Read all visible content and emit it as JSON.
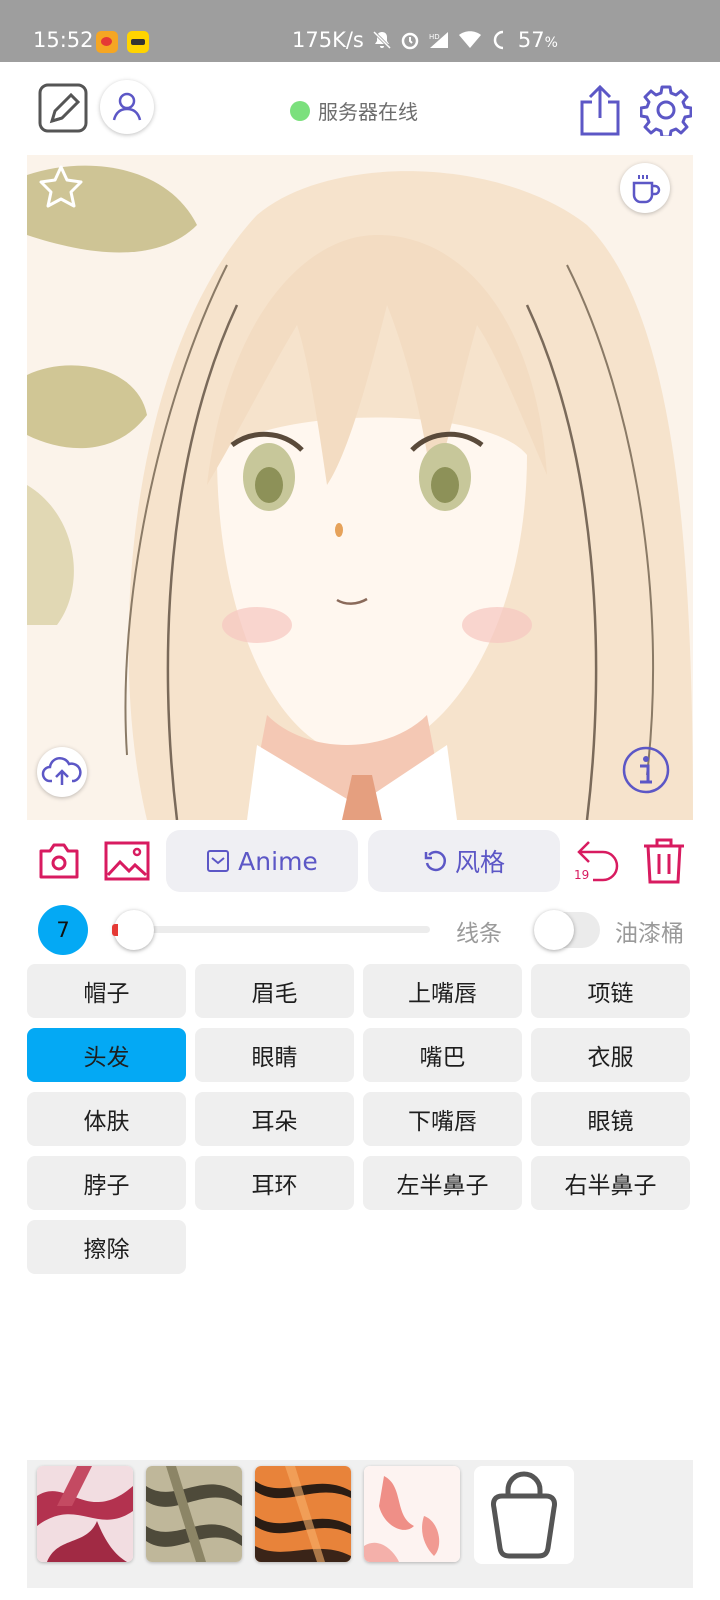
{
  "status_bar": {
    "time": "15:52",
    "network_speed": "175K/s",
    "battery": "57",
    "battery_unit": "%"
  },
  "header": {
    "server_status": "服务器在线",
    "server_status_color": "#7be07d"
  },
  "toolbar": {
    "anime_label": "Anime",
    "style_label": "风格",
    "undo_count": "19"
  },
  "controls": {
    "brush_size": "7",
    "lines_label": "线条",
    "bucket_label": "油漆桶",
    "line_slider_level": 0.0,
    "bucket_enabled": false
  },
  "parts": [
    {
      "label": "帽子",
      "active": false
    },
    {
      "label": "眉毛",
      "active": false
    },
    {
      "label": "上嘴唇",
      "active": false
    },
    {
      "label": "项链",
      "active": false
    },
    {
      "label": "头发",
      "active": true
    },
    {
      "label": "眼睛",
      "active": false
    },
    {
      "label": "嘴巴",
      "active": false
    },
    {
      "label": "衣服",
      "active": false
    },
    {
      "label": "体肤",
      "active": false
    },
    {
      "label": "耳朵",
      "active": false
    },
    {
      "label": "下嘴唇",
      "active": false
    },
    {
      "label": "眼镜",
      "active": false
    },
    {
      "label": "脖子",
      "active": false
    },
    {
      "label": "耳环",
      "active": false
    },
    {
      "label": "左半鼻子",
      "active": false
    },
    {
      "label": "右半鼻子",
      "active": false
    },
    {
      "label": "擦除",
      "active": false
    }
  ],
  "style_thumbnails": [
    "style-thumb-crimson",
    "style-thumb-olive",
    "style-thumb-tiger",
    "style-thumb-pink"
  ],
  "colors": {
    "accent": "#5c57c6",
    "danger": "#d81b60",
    "active_part": "#04a9f4"
  }
}
